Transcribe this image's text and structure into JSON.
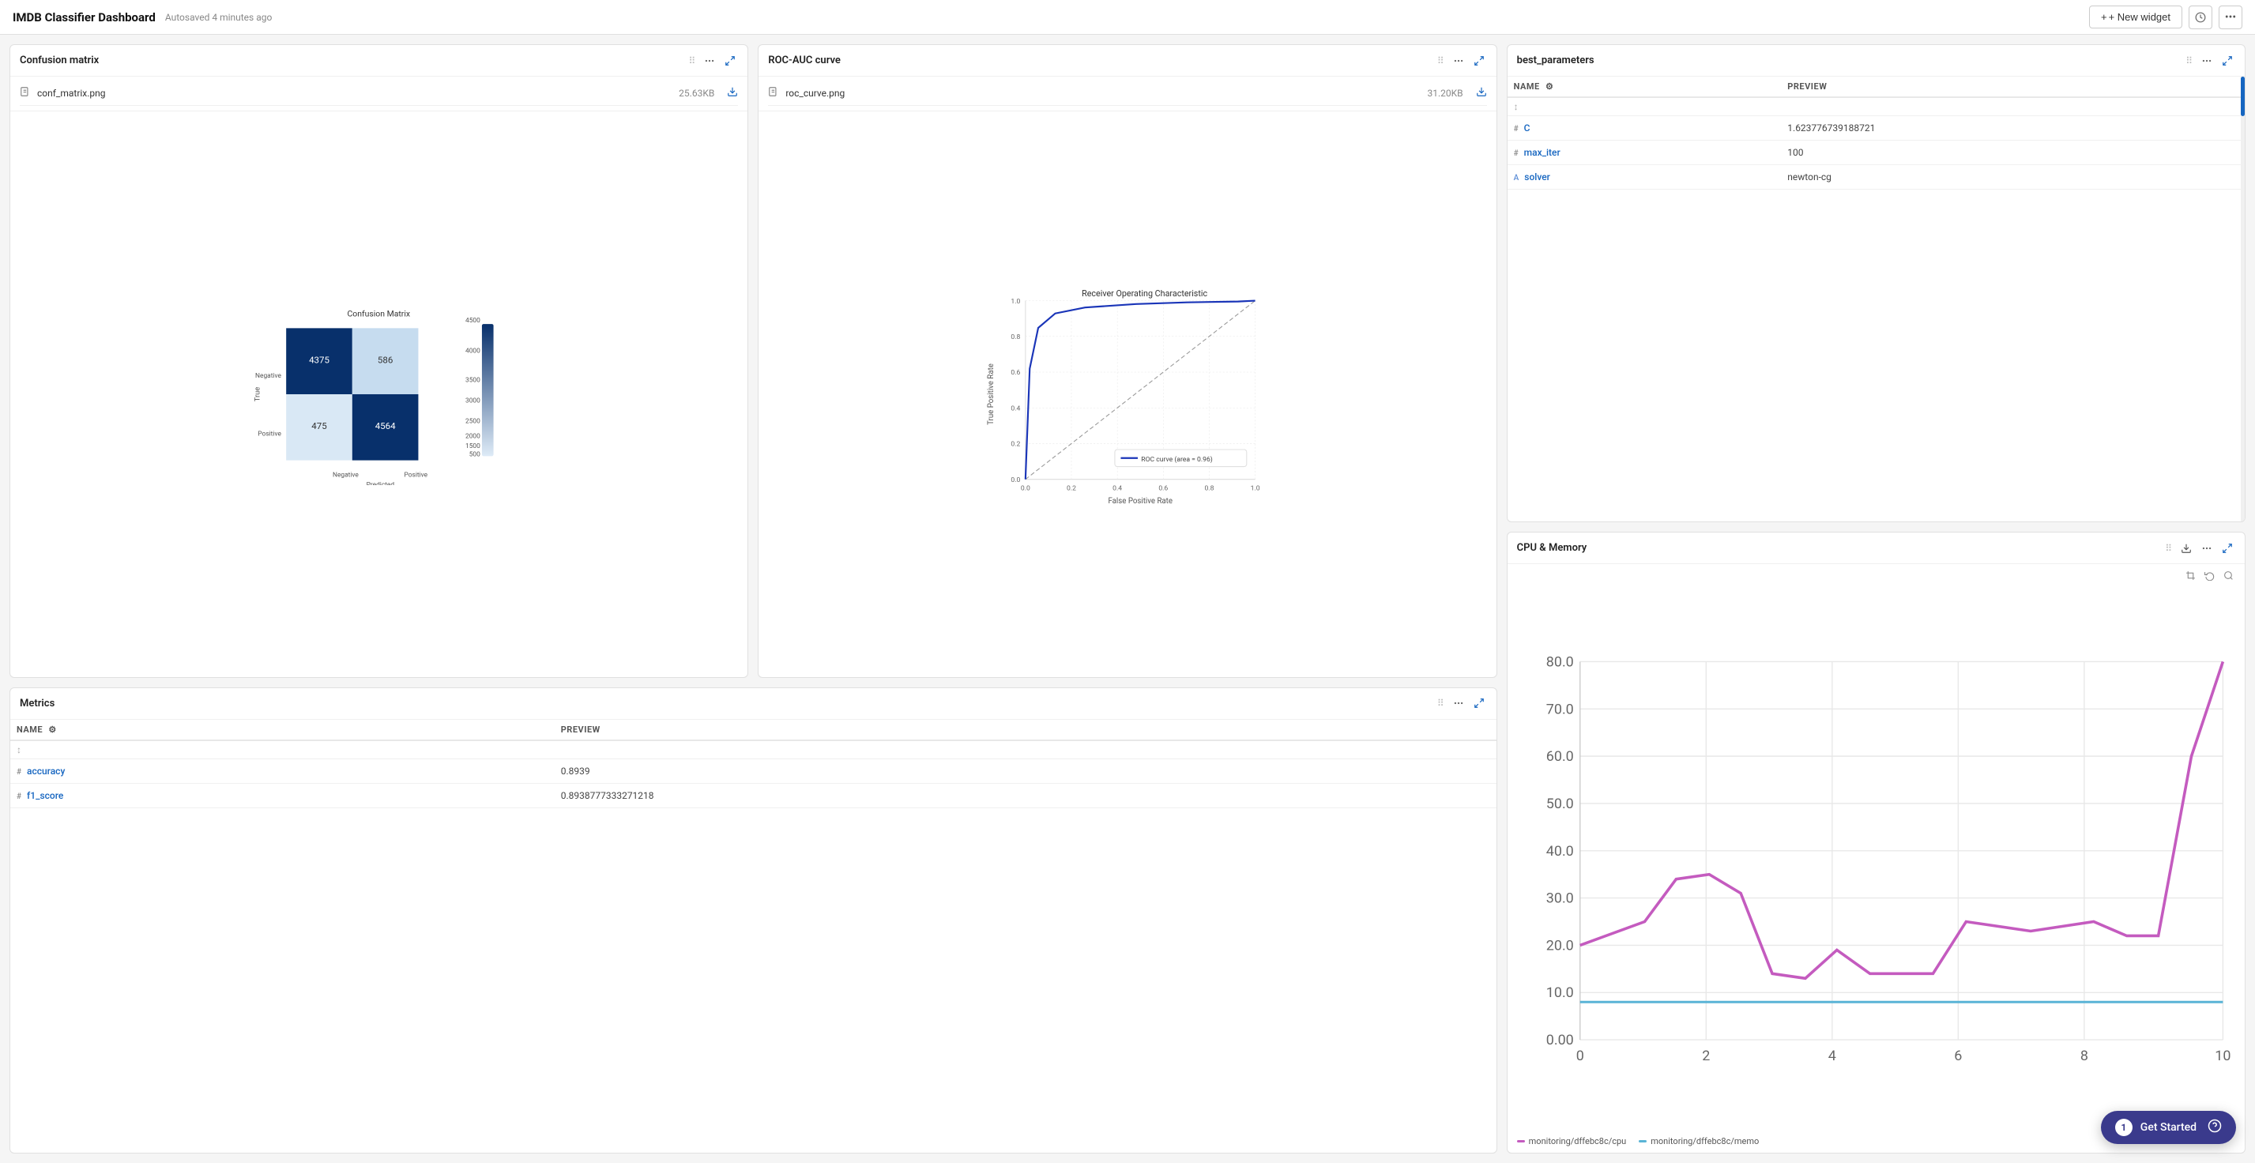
{
  "app": {
    "title": "IMDB Classifier Dashboard",
    "autosave": "Autosaved 4 minutes ago"
  },
  "toolbar": {
    "new_widget_label": "+ New widget",
    "clock_icon": "🕐",
    "more_icon": "⋯"
  },
  "widgets": {
    "confusion_matrix": {
      "title": "Confusion matrix",
      "file_name": "conf_matrix.png",
      "file_size": "25.63KB"
    },
    "roc_auc": {
      "title": "ROC-AUC curve",
      "file_name": "roc_curve.png",
      "file_size": "31.20KB",
      "chart_title": "Receiver Operating Characteristic",
      "x_label": "False Positive Rate",
      "y_label": "True Positive Rate",
      "legend": "ROC curve (area = 0.96)"
    },
    "best_parameters": {
      "title": "best_parameters",
      "col_name": "NAME",
      "col_preview": "PREVIEW",
      "rows": [
        {
          "type": "sort",
          "name": "↕",
          "preview": ""
        },
        {
          "type": "numeric",
          "name": "C",
          "preview": "1.623776739188721"
        },
        {
          "type": "numeric",
          "name": "max_iter",
          "preview": "100"
        },
        {
          "type": "string",
          "name": "solver",
          "preview": "newton-cg"
        }
      ]
    },
    "metrics": {
      "title": "Metrics",
      "col_name": "NAME",
      "col_preview": "PREVIEW",
      "rows": [
        {
          "type": "sort",
          "name": "↕",
          "preview": ""
        },
        {
          "type": "numeric",
          "name": "accuracy",
          "preview": "0.8939"
        },
        {
          "type": "numeric",
          "name": "f1_score",
          "preview": "0.8938777333271218"
        }
      ]
    },
    "cpu_memory": {
      "title": "CPU & Memory",
      "legend": [
        {
          "label": "monitoring/dffebc8c/cpu",
          "color": "#c45bbf"
        },
        {
          "label": "monitoring/dffebc8c/memo",
          "color": "#5bafc4"
        }
      ],
      "y_ticks": [
        "80.0",
        "70.0",
        "60.0",
        "50.0",
        "40.0",
        "30.0",
        "20.0",
        "10.0",
        "0.00"
      ],
      "x_ticks": [
        "0",
        "2",
        "4",
        "6",
        "8",
        "10"
      ],
      "cpu_data": [
        {
          "x": 0,
          "y": 20
        },
        {
          "x": 1,
          "y": 25
        },
        {
          "x": 1.5,
          "y": 34
        },
        {
          "x": 2,
          "y": 35
        },
        {
          "x": 2.5,
          "y": 31
        },
        {
          "x": 3,
          "y": 14
        },
        {
          "x": 3.5,
          "y": 13
        },
        {
          "x": 4,
          "y": 19
        },
        {
          "x": 4.5,
          "y": 14
        },
        {
          "x": 5,
          "y": 14
        },
        {
          "x": 5.5,
          "y": 14
        },
        {
          "x": 6,
          "y": 25
        },
        {
          "x": 7,
          "y": 23
        },
        {
          "x": 8,
          "y": 25
        },
        {
          "x": 8.5,
          "y": 22
        },
        {
          "x": 9,
          "y": 22
        },
        {
          "x": 9.5,
          "y": 60
        },
        {
          "x": 10,
          "y": 80
        }
      ],
      "memory_data": [
        {
          "x": 0,
          "y": 8
        },
        {
          "x": 10,
          "y": 8
        }
      ]
    }
  },
  "notification": {
    "count": "1",
    "label": "Get Started"
  }
}
